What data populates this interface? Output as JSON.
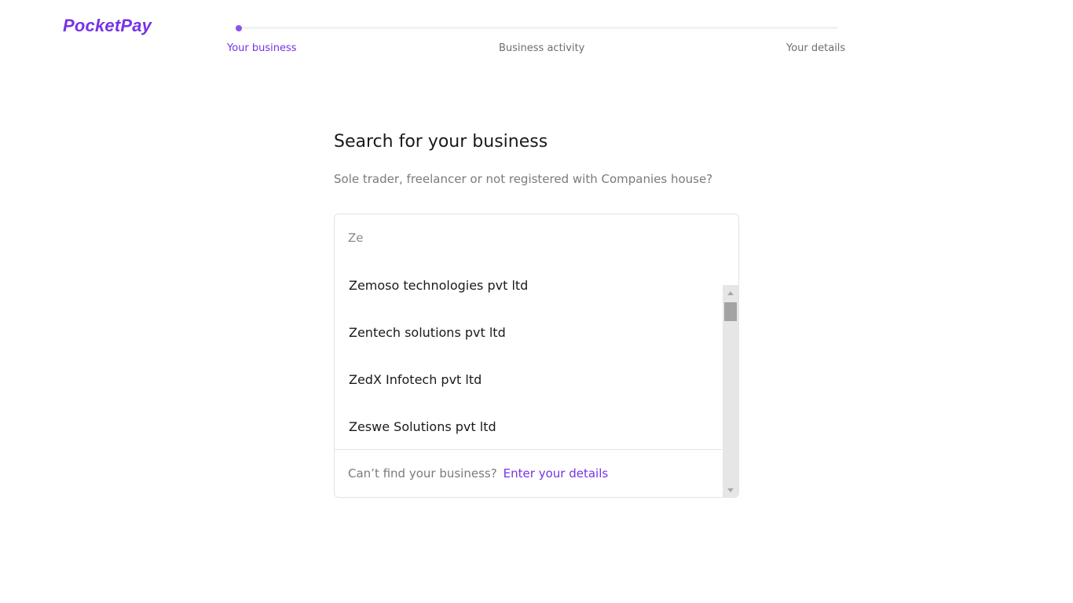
{
  "brand": {
    "name": "PocketPay",
    "color": "#7633e6"
  },
  "stepper": {
    "steps": [
      {
        "label": "Your business",
        "active": true
      },
      {
        "label": "Business activity",
        "active": false
      },
      {
        "label": "Your details",
        "active": false
      }
    ]
  },
  "main": {
    "title": "Search for your business",
    "subtitle": "Sole trader, freelancer or not registered with Companies house?"
  },
  "search": {
    "value": "Ze",
    "results": [
      "Zemoso technologies pvt ltd",
      "Zentech solutions pvt ltd",
      "ZedX Infotech pvt ltd",
      "Zeswe Solutions pvt ltd"
    ],
    "footer_text": "Can’t find your business?",
    "footer_link": "Enter your details"
  }
}
